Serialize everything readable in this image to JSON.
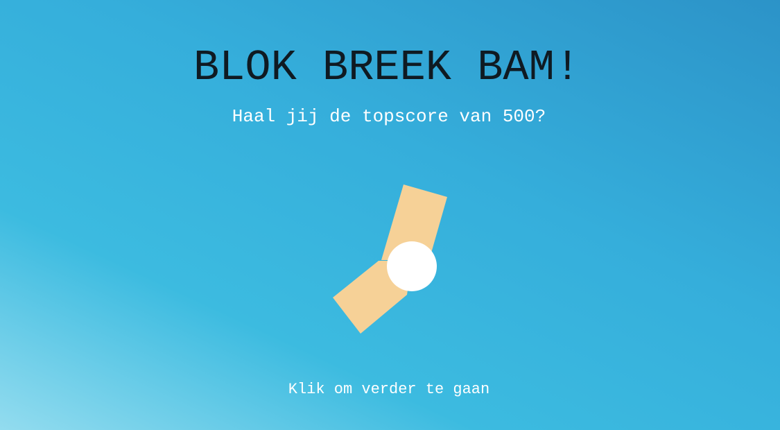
{
  "game": {
    "title": "BLOK BREEK BAM!",
    "subtitle": "Haal jij de topscore van 500?",
    "continue_label": "Klik om verder te gaan"
  },
  "colors": {
    "background_top": "#2c93c8",
    "background_mid": "#3cbbe0",
    "background_corner": "#93dcef",
    "title_text": "#0f1a22",
    "light_text": "#ffffff",
    "block": "#f6d197",
    "ball": "#ffffff"
  }
}
